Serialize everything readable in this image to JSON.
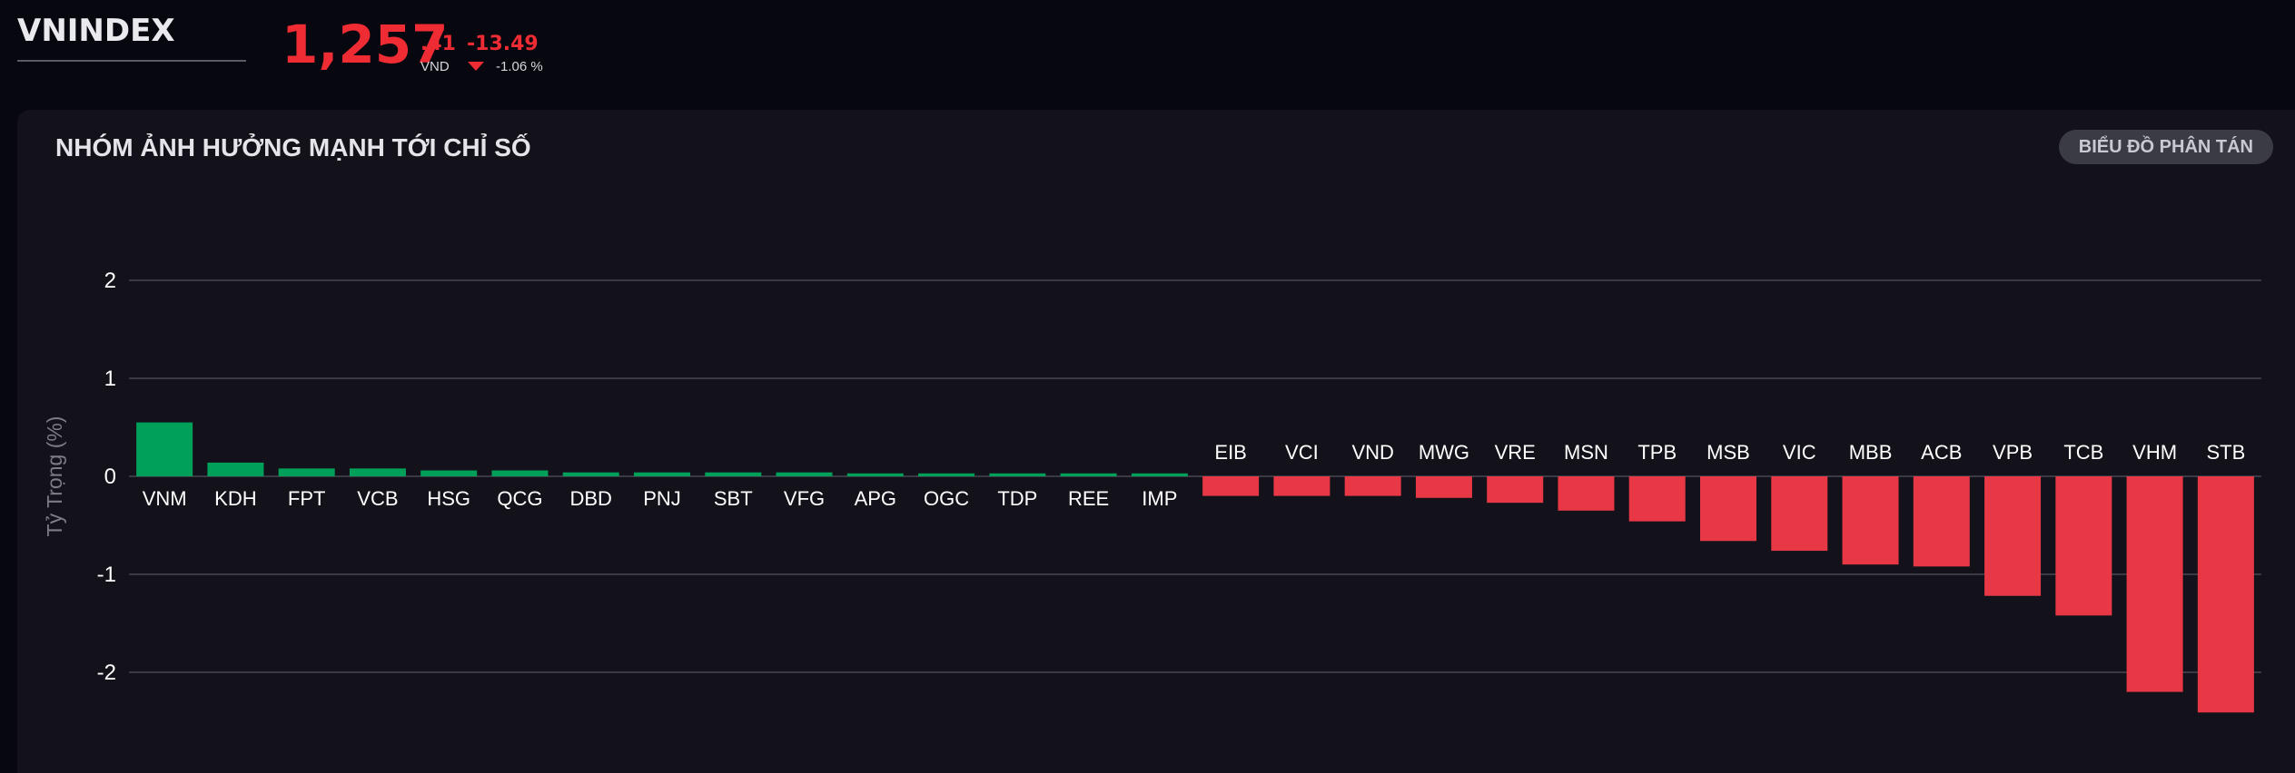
{
  "header": {
    "index_name": "VNINDEX",
    "price_int": "1,257",
    "price_dec": ".41",
    "currency": "VND",
    "change": "-13.49",
    "change_pct": "-1.06 %"
  },
  "panel": {
    "title": "NHÓM ẢNH HƯỞNG MẠNH TỚI CHỈ SỐ",
    "scatter_button": "BIỂU ĐỒ PHÂN TÁN"
  },
  "colors": {
    "positive": "#00a05a",
    "negative": "#e83745",
    "grid": "#3a3a44",
    "axis_text": "#ffffff",
    "ylabel": "#7d7d88"
  },
  "chart_data": {
    "type": "bar",
    "ylabel": "Tỷ Trọng (%)",
    "yticks": [
      2,
      1,
      0,
      -1,
      -2
    ],
    "ylim": [
      -2.5,
      2.3
    ],
    "grid": true,
    "categories": [
      "VNM",
      "KDH",
      "FPT",
      "VCB",
      "HSG",
      "QCG",
      "DBD",
      "PNJ",
      "SBT",
      "VFG",
      "APG",
      "OGC",
      "TDP",
      "REE",
      "IMP",
      "EIB",
      "VCI",
      "VND",
      "MWG",
      "VRE",
      "MSN",
      "TPB",
      "MSB",
      "VIC",
      "MBB",
      "ACB",
      "VPB",
      "TCB",
      "VHM",
      "STB"
    ],
    "values": [
      0.55,
      0.14,
      0.08,
      0.08,
      0.06,
      0.06,
      0.04,
      0.04,
      0.04,
      0.04,
      0.03,
      0.03,
      0.03,
      0.03,
      0.03,
      -0.2,
      -0.2,
      -0.2,
      -0.22,
      -0.27,
      -0.35,
      -0.46,
      -0.66,
      -0.76,
      -0.9,
      -0.92,
      -1.22,
      -1.42,
      -2.2,
      -2.41
    ]
  }
}
